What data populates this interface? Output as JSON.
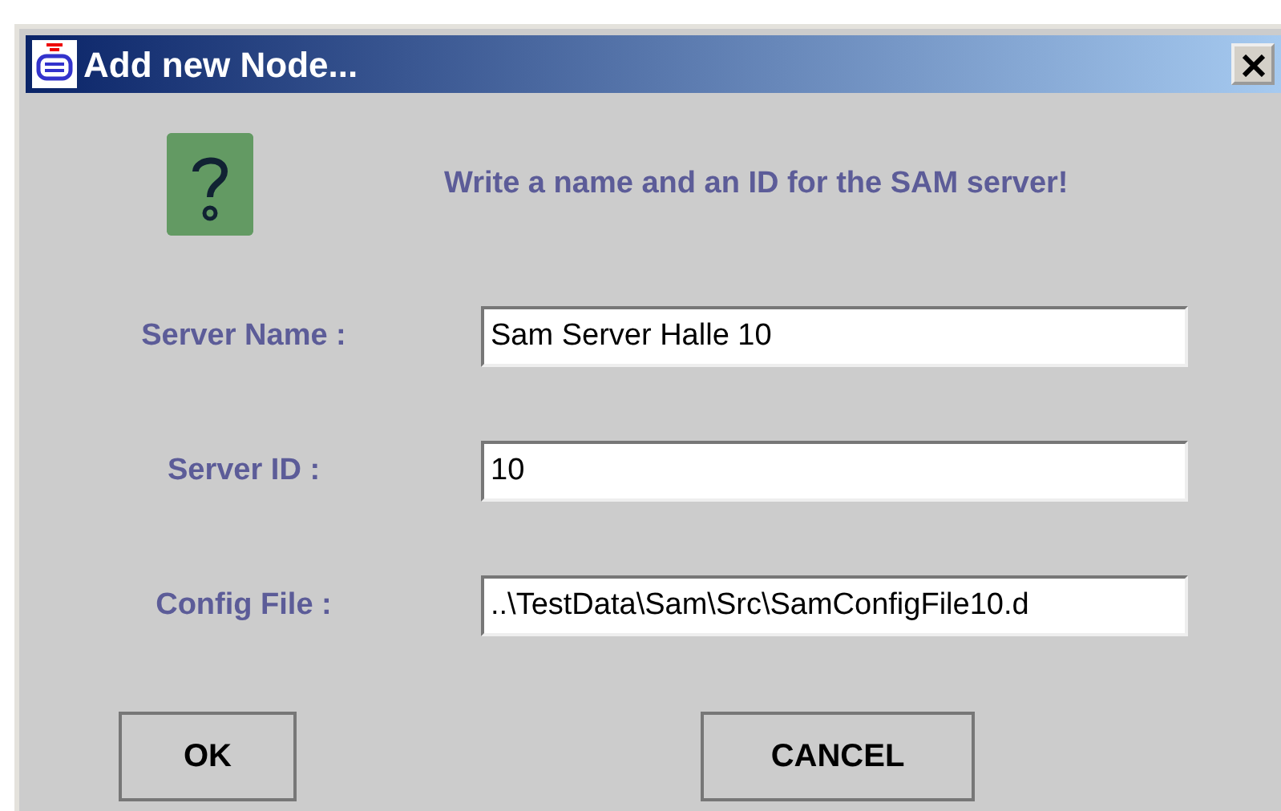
{
  "window": {
    "title": "Add new Node..."
  },
  "message": "Write a name and an ID for the SAM server!",
  "fields": [
    {
      "label": "Server Name :",
      "value": "Sam Server Halle 10"
    },
    {
      "label": "Server ID :",
      "value": "10"
    },
    {
      "label": "Config File :",
      "value": "..\\TestData\\Sam\\Src\\SamConfigFile10.d"
    }
  ],
  "buttons": [
    {
      "label": "OK"
    },
    {
      "label": "CANCEL"
    }
  ]
}
